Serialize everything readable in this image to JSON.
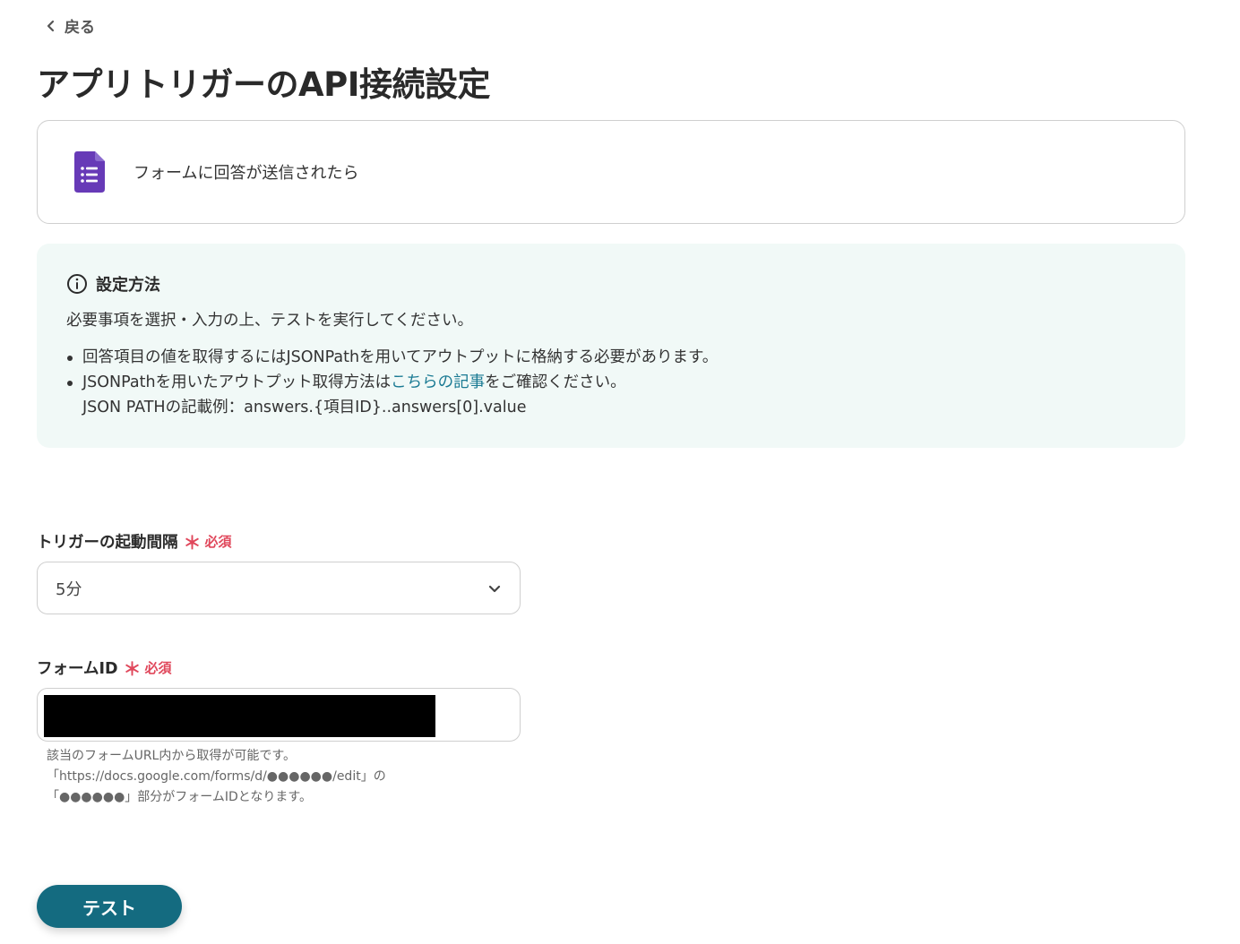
{
  "nav": {
    "back_label": "戻る"
  },
  "page": {
    "title": "アプリトリガーのAPI接続設定"
  },
  "app_card": {
    "trigger_label": "フォームに回答が送信されたら",
    "icon": "google-forms-icon"
  },
  "info": {
    "heading": "設定方法",
    "description": "必要事項を選択・入力の上、テストを実行してください。",
    "bullet1": "回答項目の値を取得するにはJSONPathを用いてアウトプットに格納する必要があります。",
    "bullet2_prefix": "JSONPathを用いたアウトプット取得方法は",
    "bullet2_link": "こちらの記事",
    "bullet2_suffix": "をご確認ください。",
    "bullet2_line2": "JSON PATHの記載例：answers.{項目ID}..answers[0].value"
  },
  "interval_field": {
    "label": "トリガーの起動間隔",
    "required_star": "＊",
    "required_text": "必須",
    "value": "5分"
  },
  "form_id_field": {
    "label": "フォームID",
    "required_star": "＊",
    "required_text": "必須",
    "hint_line1": "該当のフォームURL内から取得が可能です。",
    "hint_line2": "「https://docs.google.com/forms/d/●●●●●●/edit」の",
    "hint_line3": "「●●●●●●」部分がフォームIDとなります。"
  },
  "actions": {
    "test_label": "テスト"
  },
  "colors": {
    "accent": "#146b80",
    "required": "#e0475b",
    "link": "#1a7a93",
    "info_bg": "#f1f9f7",
    "forms_purple": "#673ab7"
  }
}
